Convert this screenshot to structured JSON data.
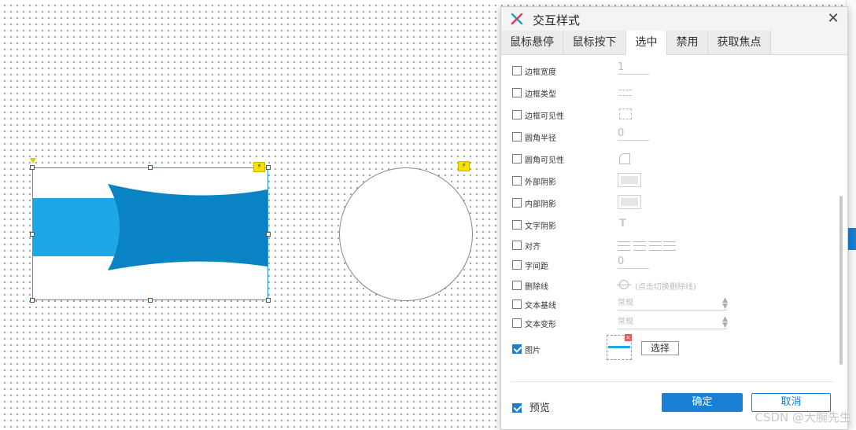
{
  "dialog": {
    "title": "交互样式",
    "close_label": "✕",
    "tabs": [
      {
        "label": "鼠标悬停",
        "active": false
      },
      {
        "label": "鼠标按下",
        "active": false
      },
      {
        "label": "选中",
        "active": true
      },
      {
        "label": "禁用",
        "active": false
      },
      {
        "label": "获取焦点",
        "active": false
      }
    ],
    "props": {
      "border_width": {
        "label": "边框宽度",
        "checked": false,
        "value": "1"
      },
      "border_type": {
        "label": "边框类型",
        "checked": false
      },
      "border_visibility": {
        "label": "边框可见性",
        "checked": false
      },
      "corner_radius": {
        "label": "圆角半径",
        "checked": false,
        "value": "0"
      },
      "corner_visibility": {
        "label": "圆角可见性",
        "checked": false
      },
      "outer_shadow": {
        "label": "外部阴影",
        "checked": false
      },
      "inner_shadow": {
        "label": "内部阴影",
        "checked": false
      },
      "text_shadow": {
        "label": "文字阴影",
        "checked": false
      },
      "align": {
        "label": "对齐",
        "checked": false
      },
      "letter_spacing": {
        "label": "字间距",
        "checked": false,
        "value": "0"
      },
      "strikethrough": {
        "label": "删除线",
        "checked": false,
        "hint": "(点击切换删除线)"
      },
      "baseline": {
        "label": "文本基线",
        "checked": false,
        "value": "常规"
      },
      "transform": {
        "label": "文本变形",
        "checked": false,
        "value": "常规"
      },
      "image": {
        "label": "图片",
        "checked": true,
        "button": "选择"
      }
    },
    "preview": {
      "label": "预览",
      "checked": true
    },
    "ok_label": "确定",
    "cancel_label": "取消"
  },
  "canvas": {
    "accent_light": "#1ea7e8",
    "accent_dark": "#0a83c4"
  },
  "watermark": "CSDN @大腕先生"
}
